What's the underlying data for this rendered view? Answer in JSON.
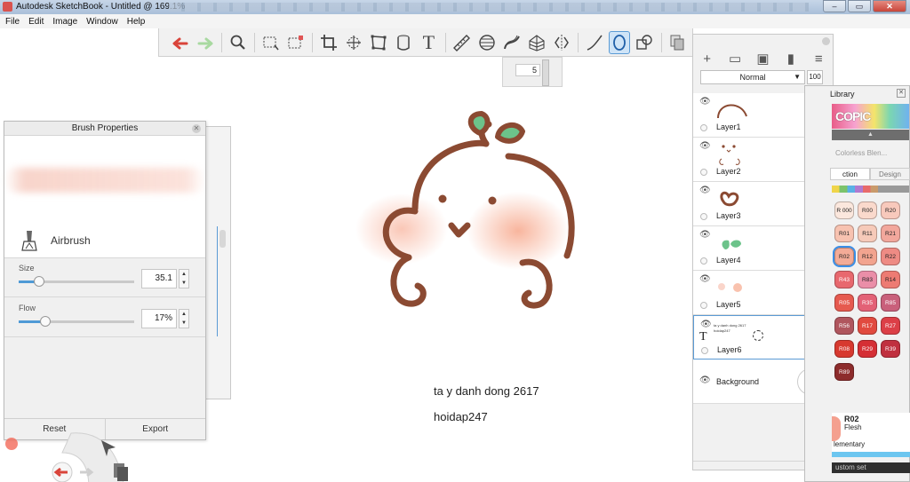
{
  "window": {
    "title": "Autodesk SketchBook - Untitled @ 169.1%",
    "controls": [
      "–",
      "▭",
      "✕"
    ]
  },
  "menu": [
    "File",
    "Edit",
    "Image",
    "Window",
    "Help"
  ],
  "toolbar": {
    "tools": [
      "undo",
      "redo",
      "zoom",
      "select-rect",
      "select-lasso",
      "crop",
      "transform",
      "distort",
      "paint-bucket",
      "text",
      "ruler",
      "ellipse",
      "french-curve",
      "perspective",
      "symmetry",
      "line",
      "stroke",
      "shape",
      "copy-paste"
    ],
    "active_tool": "stroke"
  },
  "brush_size_slider": {
    "value": "5"
  },
  "brush_properties": {
    "title": "Brush Properties",
    "brush_name": "Airbrush",
    "size_label": "Size",
    "size_value": "35.1",
    "size_level": 0.18,
    "flow_label": "Flow",
    "flow_value": "17%",
    "flow_level": 0.23,
    "reset_label": "Reset",
    "export_label": "Export"
  },
  "canvas": {
    "caption_line1": "ta y danh dong 2617",
    "caption_line2": "hoidap247",
    "line_color": "#8b4a32",
    "blush_color": "#f8b49e",
    "leaf_color": "#6cc38a"
  },
  "layers": {
    "blend_mode": "Normal",
    "opacity": "100",
    "items": [
      {
        "name": "Layer1"
      },
      {
        "name": "Layer2"
      },
      {
        "name": "Layer3"
      },
      {
        "name": "Layer4"
      },
      {
        "name": "Layer5"
      },
      {
        "name": "Layer6",
        "thumb_text1": "ta y danh dong 2617",
        "thumb_text2": "hoidap247"
      },
      {
        "name": "Background"
      }
    ],
    "selected": "Layer6"
  },
  "copic": {
    "title": "Library",
    "logo": "COPIC",
    "blend_label": "Colorless Blen...",
    "tab_collection": "ction",
    "tab_design": "Design",
    "swatches": [
      {
        "code": "R 000",
        "color": "#fbe7dd"
      },
      {
        "code": "R00",
        "color": "#fad9cc"
      },
      {
        "code": "R20",
        "color": "#f8c9bc"
      },
      {
        "code": "R01",
        "color": "#f7c2b0"
      },
      {
        "code": "R11",
        "color": "#f6cab9"
      },
      {
        "code": "R21",
        "color": "#f2a79c"
      },
      {
        "code": "R02",
        "color": "#f3ab97"
      },
      {
        "code": "R12",
        "color": "#f2a48f"
      },
      {
        "code": "R22",
        "color": "#ee8b84"
      },
      {
        "code": "R43",
        "color": "#e8686e"
      },
      {
        "code": "R83",
        "color": "#ea8ea8"
      },
      {
        "code": "R14",
        "color": "#ed7b73"
      },
      {
        "code": "R05",
        "color": "#e65a4f"
      },
      {
        "code": "R35",
        "color": "#e36176"
      },
      {
        "code": "R85",
        "color": "#c9607b"
      },
      {
        "code": "R56",
        "color": "#b0565e"
      },
      {
        "code": "R17",
        "color": "#e14a3f"
      },
      {
        "code": "R27",
        "color": "#dc3f47"
      },
      {
        "code": "R08",
        "color": "#d7392f"
      },
      {
        "code": "R29",
        "color": "#d52f35"
      },
      {
        "code": "R39",
        "color": "#c0303f"
      },
      {
        "code": "R89",
        "color": "#8d2c2c"
      }
    ],
    "selected_code": "R02",
    "info_code": "R02",
    "info_name": "Flesh",
    "info_comp": "lementary",
    "footer": "ustom set"
  }
}
